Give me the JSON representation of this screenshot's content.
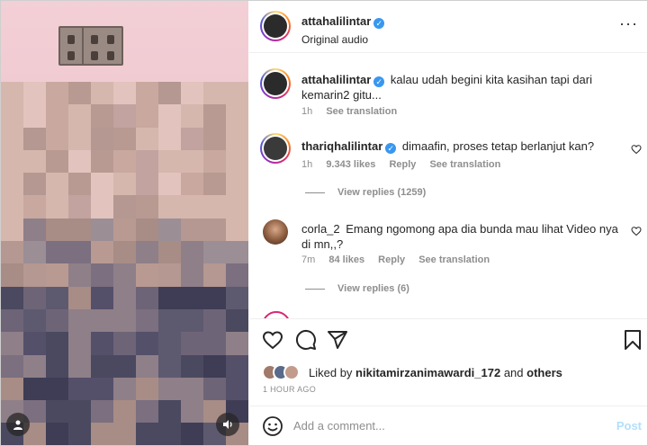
{
  "post_header": {
    "username": "attahalilintar",
    "subtitle": "Original audio",
    "more_icon": "more-horizontal-icon"
  },
  "caption": {
    "username": "attahalilintar",
    "text": "kalau udah begini kita kasihan tapi dari kemarin2 gitu...",
    "time": "1h",
    "see_translation": "See translation"
  },
  "comments": [
    {
      "username": "thariqhalilintar",
      "verified": true,
      "text": "dimaafin, proses tetap berlanjut kan?",
      "time": "1h",
      "likes": "9.343 likes",
      "reply": "Reply",
      "see_translation": "See translation",
      "view_replies": "View replies (1259)"
    },
    {
      "username": "corla_2",
      "verified": false,
      "text": "Emang ngomong apa dia bunda mau lihat Video nya di mn,,?",
      "time": "7m",
      "likes": "84 likes",
      "reply": "Reply",
      "see_translation": "See translation",
      "view_replies": "View replies (6)"
    }
  ],
  "actions": {
    "like_icon": "heart-icon",
    "comment_icon": "comment-icon",
    "share_icon": "send-icon",
    "save_icon": "bookmark-icon"
  },
  "liked_by": {
    "prefix": "Liked by",
    "user": "nikitamirzanimawardi_172",
    "and": "and",
    "others": "others"
  },
  "timestamp": "1 HOUR AGO",
  "add_comment": {
    "placeholder": "Add a comment...",
    "post_label": "Post"
  },
  "colors": {
    "accent": "#3897f0",
    "post_disabled": "#b2dffc",
    "muted": "#8e8e8e"
  }
}
